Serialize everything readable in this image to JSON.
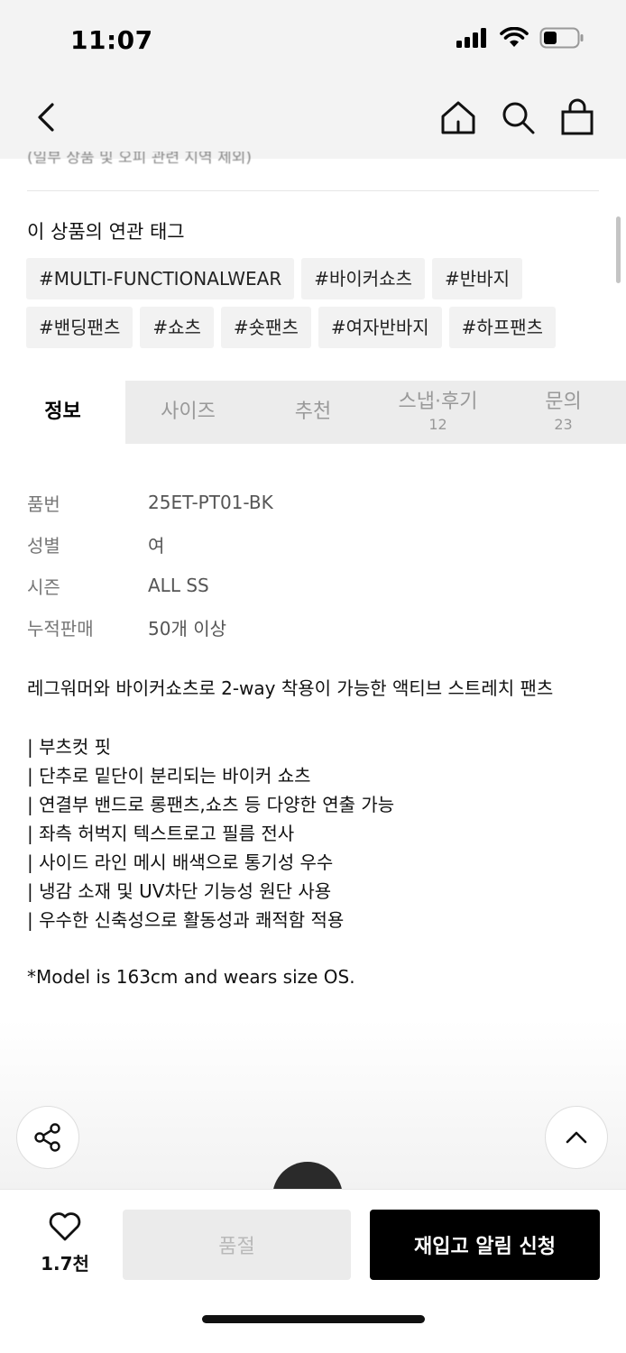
{
  "status": {
    "time": "11:07"
  },
  "cut_text": "(일부 상품 및 오피 관련 지역 제외)",
  "tags": {
    "title": "이 상품의 연관 태그",
    "items": [
      "#MULTI-FUNCTIONALWEAR",
      "#바이커쇼츠",
      "#반바지",
      "#밴딩팬츠",
      "#쇼츠",
      "#숏팬츠",
      "#여자반바지",
      "#하프팬츠"
    ]
  },
  "tabs": [
    {
      "label": "정보",
      "count": "",
      "active": true
    },
    {
      "label": "사이즈",
      "count": ""
    },
    {
      "label": "추천",
      "count": ""
    },
    {
      "label": "스냅·후기",
      "count": "12"
    },
    {
      "label": "문의",
      "count": "23"
    }
  ],
  "info": [
    {
      "label": "품번",
      "value": "25ET-PT01-BK"
    },
    {
      "label": "성별",
      "value": "여"
    },
    {
      "label": "시즌",
      "value": "ALL SS"
    },
    {
      "label": "누적판매",
      "value": "50개 이상"
    }
  ],
  "description": {
    "headline": "레그워머와 바이커쇼츠로 2-way 착용이 가능한 액티브 스트레치 팬츠",
    "bullets": [
      "| 부츠컷 핏",
      "| 단추로 밑단이 분리되는 바이커 쇼츠",
      "| 연결부 밴드로 롱팬츠,쇼츠 등 다양한 연출 가능",
      "| 좌측 허벅지 텍스트로고 필름 전사",
      "| 사이드 라인 메시 배색으로 통기성 우수",
      "| 냉감 소재 및 UV차단 기능성 원단 사용",
      "| 우수한 신축성으로 활동성과 쾌적함 적용"
    ],
    "model_note": "*Model is 163cm and wears size OS."
  },
  "bottom": {
    "like_count": "1.7천",
    "soldout_label": "품절",
    "restock_label": "재입고 알림 신청"
  }
}
